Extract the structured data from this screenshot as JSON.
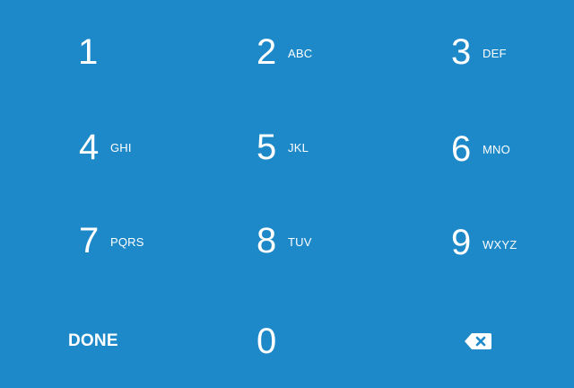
{
  "theme": {
    "background": "#1e89c9",
    "foreground": "#ffffff"
  },
  "keypad": {
    "keys": [
      {
        "digit": "1",
        "letters": ""
      },
      {
        "digit": "2",
        "letters": "ABC"
      },
      {
        "digit": "3",
        "letters": "DEF"
      },
      {
        "digit": "4",
        "letters": "GHI"
      },
      {
        "digit": "5",
        "letters": "JKL"
      },
      {
        "digit": "6",
        "letters": "MNO"
      },
      {
        "digit": "7",
        "letters": "PQRS"
      },
      {
        "digit": "8",
        "letters": "TUV"
      },
      {
        "digit": "9",
        "letters": "WXYZ"
      },
      {
        "digit": "0",
        "letters": ""
      }
    ],
    "done_label": "DONE",
    "backspace_icon": "backspace-icon"
  }
}
